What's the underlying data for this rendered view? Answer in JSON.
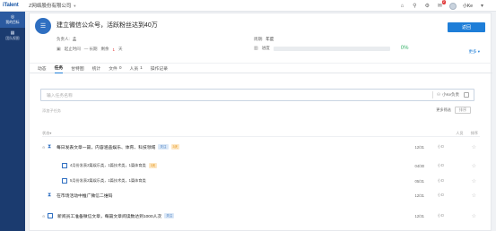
{
  "top": {
    "logo": "iTalent",
    "company": "Z网络股份有限公司",
    "notifications": "2",
    "username": "小Ke"
  },
  "sidebar": {
    "items": [
      {
        "label": "我的目标",
        "icon": "target-icon"
      },
      {
        "label": "团队视图",
        "icon": "team-icon"
      }
    ]
  },
  "header": {
    "title": "建立微信公众号，活跃粉丝达到40万",
    "return_label": "返回",
    "owner_label": "负责人:",
    "owner_value": "孟",
    "cycle_label": "周期:",
    "cycle_value": "年度",
    "date_label": "起止时间",
    "date_sep": "— 长期",
    "remaining_label": "剩余",
    "remaining_value": "1",
    "remaining_unit": "天",
    "progress_label": "进度",
    "progress_pct": "0%",
    "progress_value": 0,
    "more_label": "更多 ▾"
  },
  "tabs": [
    {
      "label": "动态",
      "count": ""
    },
    {
      "label": "任务",
      "count": ""
    },
    {
      "label": "甘特图",
      "count": ""
    },
    {
      "label": "统计",
      "count": ""
    },
    {
      "label": "文件",
      "count": "0"
    },
    {
      "label": "人员",
      "count": "1"
    },
    {
      "label": "操作记录",
      "count": ""
    }
  ],
  "add_task": {
    "placeholder": "输入任务名称",
    "assignee": "小Ke负责"
  },
  "list": {
    "subline": "添加子任务",
    "sort_label": "更多筛选",
    "sort_btn": "排序",
    "status_col": "状态",
    "person_col": "人员",
    "sort_col": "排序"
  },
  "tasks": [
    {
      "label": "每日发表文章一篇，内容涵盖娱乐、体育、科技领域",
      "tags": [
        "关注",
        "3天"
      ],
      "date": "12/31",
      "user": "小D"
    },
    {
      "label": "4月份发表2篇娱乐类，1篇技术类，1篇体育类",
      "tags": [
        "3天"
      ],
      "date": "04/30",
      "user": "小D",
      "sub": true
    },
    {
      "label": "5月份发表2篇娱乐类，1篇技术类，1篇体育类",
      "tags": [],
      "date": "05/31",
      "user": "小D",
      "sub": true
    },
    {
      "label": "在市场活动中推广微信二维码",
      "tags": [],
      "date": "12/31",
      "user": "小D"
    },
    {
      "label": "新阅员工准备微信文章，每篇文章阅读数达到1000人次",
      "tags": [
        "关注"
      ],
      "date": "12/31",
      "user": "小D"
    }
  ],
  "colors": {
    "accent": "#1e7ed8",
    "sidebar": "#1b3b6f",
    "progress": "#38b26a"
  }
}
